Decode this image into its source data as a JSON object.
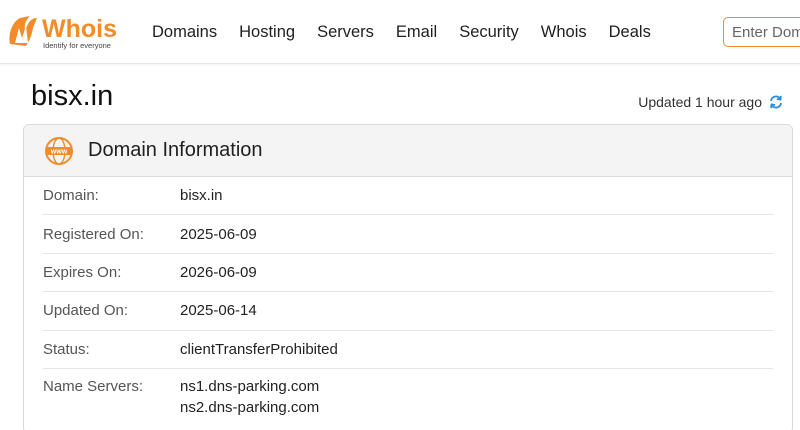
{
  "logo": {
    "name": "Whois",
    "tagline": "Identify for everyone"
  },
  "nav": [
    "Domains",
    "Hosting",
    "Servers",
    "Email",
    "Security",
    "Whois",
    "Deals"
  ],
  "search": {
    "placeholder": "Enter Domain or IP"
  },
  "page": {
    "title": "bisx.in",
    "updated": "Updated 1 hour ago"
  },
  "card": {
    "title": "Domain Information",
    "rows": [
      {
        "label": "Domain:",
        "value": "bisx.in"
      },
      {
        "label": "Registered On:",
        "value": "2025-06-09"
      },
      {
        "label": "Expires On:",
        "value": "2026-06-09"
      },
      {
        "label": "Updated On:",
        "value": "2025-06-14"
      },
      {
        "label": "Status:",
        "value": "clientTransferProhibited"
      },
      {
        "label": "Name Servers:",
        "values": [
          "ns1.dns-parking.com",
          "ns2.dns-parking.com"
        ]
      }
    ]
  },
  "icons": {
    "logo": "whois-logo-icon",
    "refresh": "refresh-icon",
    "www": "www-icon"
  },
  "colors": {
    "accent": "#f28c28",
    "refresh": "#2d8fd9"
  }
}
